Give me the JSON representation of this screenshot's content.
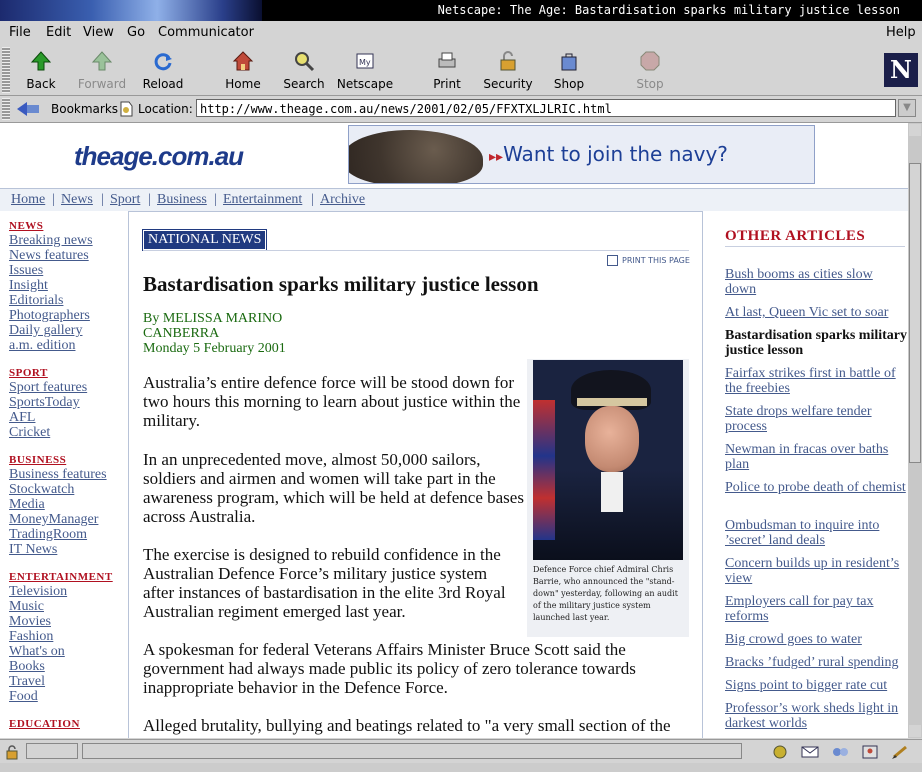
{
  "window": {
    "title": "Netscape: The Age: Bastardisation sparks military justice lesson"
  },
  "menu": [
    "File",
    "Edit",
    "View",
    "Go",
    "Communicator",
    "Help"
  ],
  "toolbar": {
    "back": "Back",
    "forward": "Forward",
    "reload": "Reload",
    "home": "Home",
    "search": "Search",
    "netscape": "Netscape",
    "print": "Print",
    "security": "Security",
    "shop": "Shop",
    "stop": "Stop"
  },
  "location": {
    "bookmarks": "Bookmarks",
    "label": "Location:",
    "url": "http://www.theage.com.au/news/2001/02/05/FFXTXLJLRIC.html"
  },
  "site": {
    "logo": "theage.com.au",
    "banner": "Want to join the navy?",
    "nav": [
      "Home",
      "News",
      "Sport",
      "Business",
      "Entertainment",
      "Archive"
    ]
  },
  "left_nav": {
    "news": {
      "title": "NEWS",
      "links": [
        "Breaking news",
        "News features",
        "Issues",
        "Insight",
        "Editorials",
        "Photographers",
        "Daily gallery",
        "a.m. edition"
      ]
    },
    "sport": {
      "title": "SPORT",
      "links": [
        "Sport features",
        "SportsToday",
        "AFL",
        "Cricket"
      ]
    },
    "business": {
      "title": "BUSINESS",
      "links": [
        "Business features",
        "Stockwatch",
        "Media",
        "MoneyManager",
        "TradingRoom",
        "IT News"
      ]
    },
    "entertainment": {
      "title": "ENTERTAINMENT",
      "links": [
        "Television",
        "Music",
        "Movies",
        "Fashion",
        "What's on",
        "Books",
        "Travel",
        "Food"
      ]
    },
    "education": {
      "title": "EDUCATION"
    }
  },
  "article": {
    "section_tag": "NATIONAL NEWS",
    "print_label": "PRINT THIS PAGE",
    "headline": "Bastardisation sparks military justice lesson",
    "byline": "By MELISSA MARINO",
    "location": "CANBERRA",
    "date": "Monday 5 February 2001",
    "photo_caption": "Defence Force chief Admiral Chris Barrie, who announced the \"stand-down\" yesterday, following an audit of the military justice system launched last year.",
    "paragraphs": [
      "Australia’s entire defence force will be stood down for two hours this morning to learn about justice within the military.",
      "In an unprecedented move, almost 50,000 sailors, soldiers and airmen and women will take part in the awareness program, which will be held at defence bases across Australia.",
      "The exercise is designed to rebuild confidence in the Australian Defence Force’s military justice system after instances of bastardisation in the elite 3rd Royal Australian regiment emerged last year.",
      "A spokesman for federal Veterans Affairs Minister Bruce Scott said the government had always made public its policy of zero tolerance towards inappropriate behavior in the Defence Force.",
      "Alleged brutality, bullying and beatings related to \"a very small section of the ADF and that has tarnished the reputation of the entire"
    ]
  },
  "other_articles": {
    "title": "OTHER ARTICLES",
    "current": "Bastardisation sparks military justice lesson",
    "items": [
      "Bush booms as cities slow down",
      "At last, Queen Vic set to soar",
      "Bastardisation sparks military justice lesson",
      "Fairfax strikes first in battle of the freebies",
      "State drops welfare tender process",
      "Newman in fracas over baths plan",
      "Police to probe death of chemist",
      "Ombudsman to inquire into ’secret’ land deals",
      "Concern builds up in resident’s view",
      "Employers call for pay tax reforms",
      "Big crowd goes to water",
      "Bracks ’fudged’ rural spending",
      "Signs point to bigger rate cut",
      "Professor’s work sheds light in darkest worlds"
    ]
  }
}
